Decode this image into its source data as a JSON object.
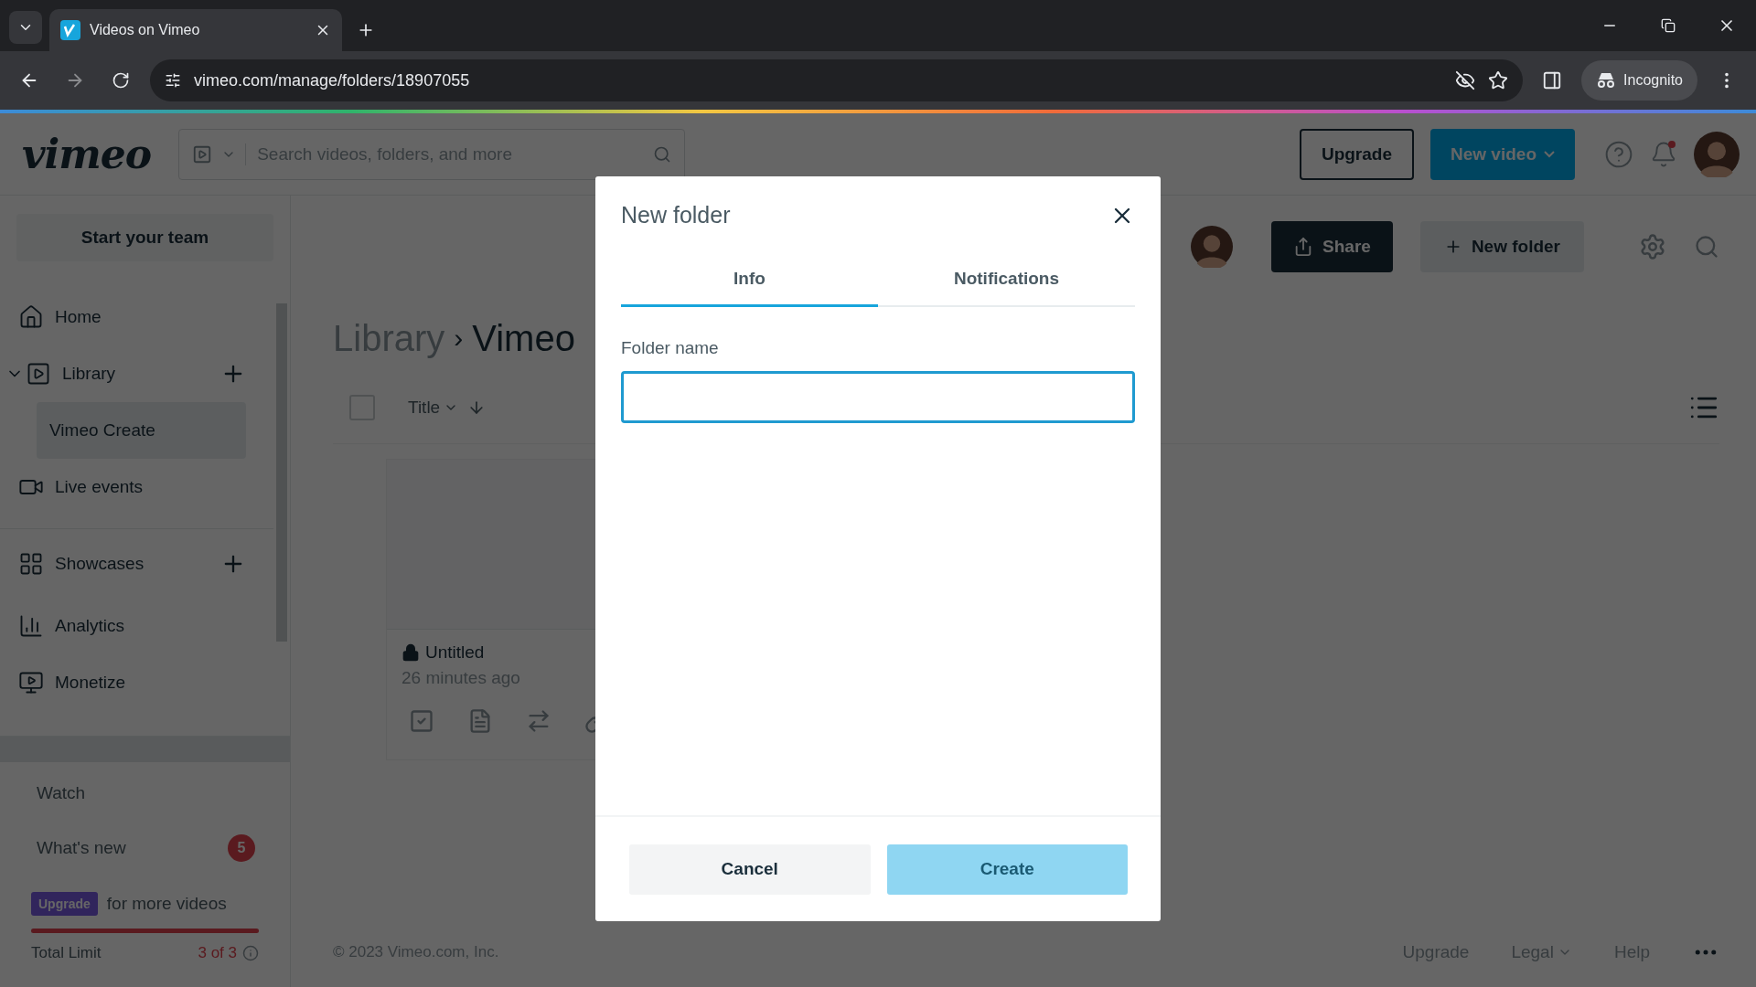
{
  "browser": {
    "tab_title": "Videos on Vimeo",
    "url": "vimeo.com/manage/folders/18907055",
    "profile_label": "Incognito"
  },
  "header": {
    "logo": "vimeo",
    "search": {
      "placeholder": "Search videos, folders, and more"
    },
    "upgrade": "Upgrade",
    "new_video": "New video"
  },
  "sidebar": {
    "team_button": "Start your team",
    "items": [
      {
        "label": "Home"
      },
      {
        "label": "Library",
        "expanded": true,
        "add": true,
        "children": [
          {
            "label": "Vimeo Create",
            "selected": true
          }
        ]
      },
      {
        "label": "Live events"
      },
      {
        "label": "Showcases",
        "add": true
      },
      {
        "label": "Analytics"
      },
      {
        "label": "Monetize"
      }
    ],
    "links": [
      {
        "label": "Watch"
      },
      {
        "label": "What's new",
        "badge": "5"
      }
    ],
    "upgrade_badge": "Upgrade",
    "upgrade_text": "for more videos",
    "limit": {
      "label": "Total Limit",
      "reading": "3 of 3",
      "level": 1
    }
  },
  "main": {
    "breadcrumb": [
      "Library",
      "Vimeo"
    ],
    "breadcrumb_separator": "›",
    "share": "Share",
    "new_folder": "New folder",
    "sort": "Title",
    "select_all_checked": false,
    "videos": [
      {
        "title": "Untitled",
        "time": "26 minutes ago"
      }
    ]
  },
  "footer": {
    "copyright": "© 2023 Vimeo.com, Inc.",
    "links": [
      {
        "label": "Upgrade"
      },
      {
        "label": "Legal",
        "menu": true
      },
      {
        "label": "Help"
      }
    ]
  },
  "dialog": {
    "title": "New folder",
    "tabs": [
      {
        "label": "Info",
        "selected": true
      },
      {
        "label": "Notifications",
        "selected": false
      }
    ],
    "field_label": "Folder name",
    "cancel": "Cancel",
    "create": "Create",
    "create_disabled": true
  }
}
